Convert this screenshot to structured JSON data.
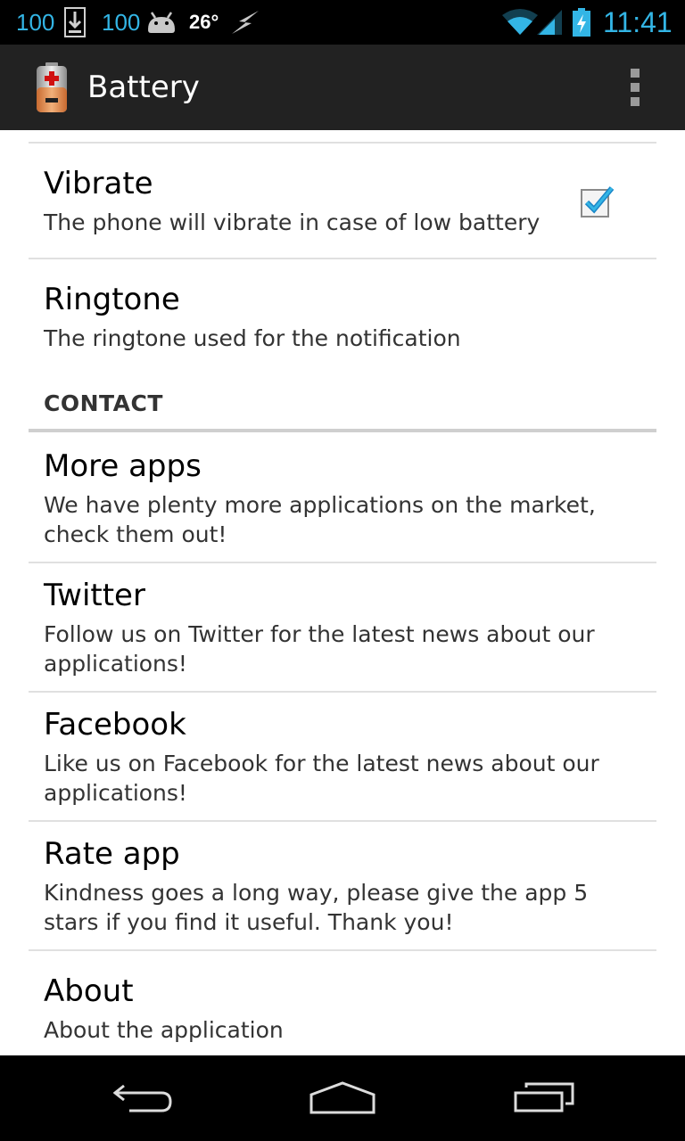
{
  "status_bar": {
    "battery_left_1": "100",
    "battery_left_2": "100",
    "temperature": "26°",
    "time": "11:41"
  },
  "action_bar": {
    "title": "Battery"
  },
  "preferences": [
    {
      "title": "Vibrate",
      "summary": "The phone will vibrate in case of low battery",
      "checked": true
    },
    {
      "title": "Ringtone",
      "summary": "The ringtone used for the notification"
    }
  ],
  "category": {
    "label": "CONTACT"
  },
  "contact_items": [
    {
      "title": "More apps",
      "summary": "We have plenty more applications on the market, check them out!"
    },
    {
      "title": "Twitter",
      "summary": "Follow us on Twitter for the latest news about our applications!"
    },
    {
      "title": "Facebook",
      "summary": "Like us on Facebook for the latest news about our applications!"
    },
    {
      "title": "Rate app",
      "summary": "Kindness goes a long way, please give the app 5 stars if you find it useful. Thank you!"
    },
    {
      "title": "About",
      "summary": "About the application"
    }
  ],
  "colors": {
    "accent": "#33b5e5",
    "action_bar": "#222222",
    "status_bar": "#000000"
  },
  "icons": {
    "status": [
      "download-icon",
      "android-icon",
      "charging-icon",
      "wifi-icon",
      "signal-icon",
      "battery-icon"
    ],
    "nav": [
      "back-icon",
      "home-icon",
      "recent-apps-icon"
    ]
  }
}
